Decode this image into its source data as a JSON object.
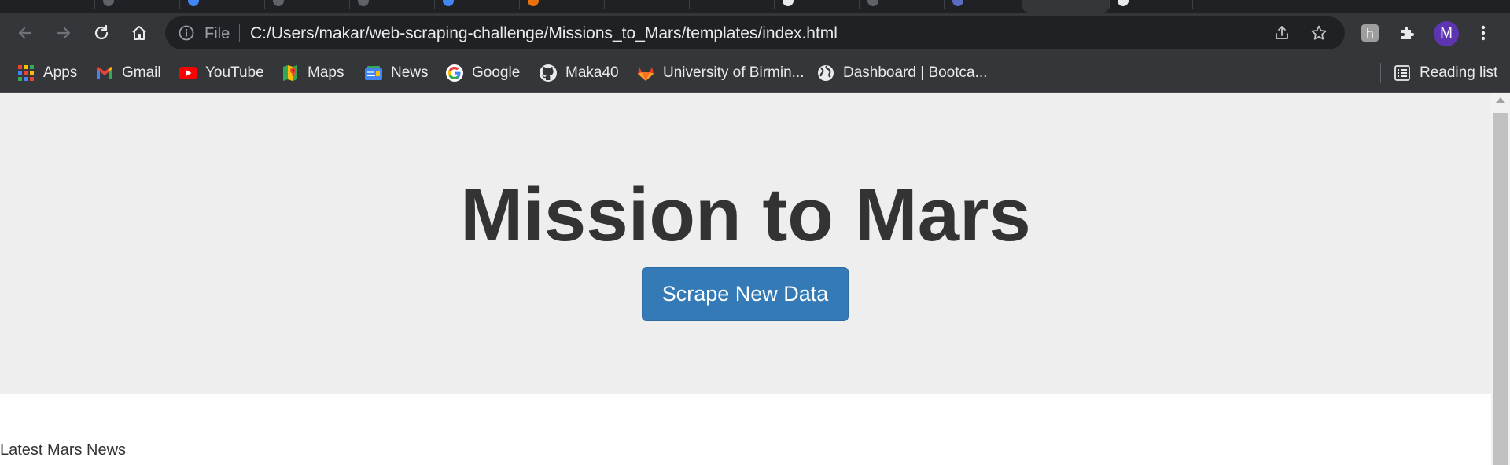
{
  "browser": {
    "address_bar": {
      "scheme_label": "File",
      "url": "C:/Users/makar/web-scraping-challenge/Missions_to_Mars/templates/index.html"
    },
    "profile_initial": "M",
    "bookmarks": [
      {
        "label": "Apps",
        "icon": "apps-grid-icon"
      },
      {
        "label": "Gmail",
        "icon": "gmail-icon"
      },
      {
        "label": "YouTube",
        "icon": "youtube-icon"
      },
      {
        "label": "Maps",
        "icon": "maps-icon"
      },
      {
        "label": "News",
        "icon": "news-icon"
      },
      {
        "label": "Google",
        "icon": "google-icon"
      },
      {
        "label": "Maka40",
        "icon": "github-icon"
      },
      {
        "label": "University of Birmin...",
        "icon": "gitlab-icon"
      },
      {
        "label": "Dashboard | Bootca...",
        "icon": "globe-icon"
      }
    ],
    "reading_list_label": "Reading list"
  },
  "page": {
    "title": "Mission to Mars",
    "scrape_button_label": "Scrape New Data",
    "news_heading": "Latest Mars News"
  },
  "colors": {
    "chrome_dark": "#35363a",
    "omnibox": "#202124",
    "jumbotron": "#eeeeee",
    "button_primary": "#337ab7",
    "avatar": "#5e35b1"
  }
}
